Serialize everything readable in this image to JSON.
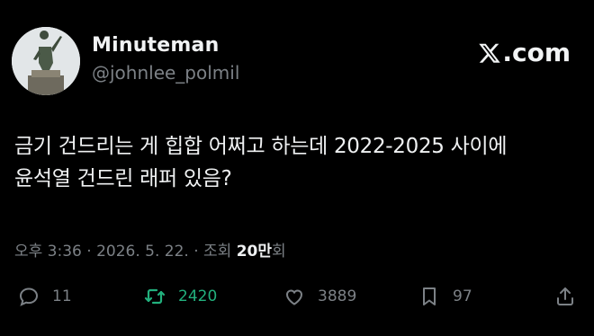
{
  "user": {
    "display_name": "Minuteman",
    "handle": "@johnlee_polmil"
  },
  "brand": {
    "label": ".com",
    "icon": "x-logo-icon"
  },
  "tweet": {
    "line1": "금기 건드리는 게 힙합 어쩌고 하는데 2022-2025 사이에",
    "line2": "윤석열 건드린 래퍼 있음?"
  },
  "meta": {
    "time": "오후 3:36",
    "date": "2026. 5. 22.",
    "views_label": "조회",
    "views_count": "20만",
    "views_suffix": "회"
  },
  "actions": {
    "replies": "11",
    "retweets": "2420",
    "likes": "3889",
    "bookmarks": "97"
  },
  "colors": {
    "background": "#000000",
    "retweet_active": "#22b07d",
    "muted": "#7c8186"
  }
}
